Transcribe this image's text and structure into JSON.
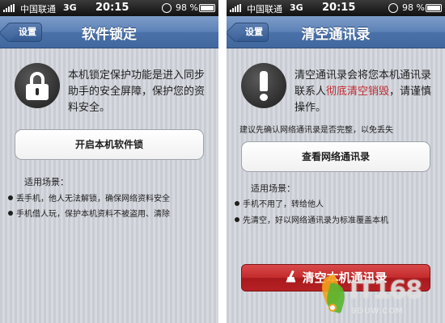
{
  "status_bar": {
    "carrier": "中国联通",
    "network": "3G",
    "time": "20:15",
    "battery_pct": "98 %",
    "battery_level": 0.98
  },
  "left_screen": {
    "back_label": "设置",
    "title": "软件锁定",
    "icon": "lock-icon",
    "description": "本机锁定保护功能是进入同步助手的安全屏障，保护您的资料安全。",
    "button_label": "开启本机软件锁",
    "scenarios_title": "适用场景：",
    "scenarios": [
      "丢手机，他人无法解锁，确保网络资料安全",
      "手机借人玩，保护本机资料不被盗用、清除"
    ]
  },
  "right_screen": {
    "back_label": "设置",
    "title": "清空通讯录",
    "icon": "exclamation-icon",
    "description_part1": "清空通讯录会将您本机通讯录联系人",
    "description_highlight": "彻底清空销毁",
    "description_part2": "，请谨慎操作。",
    "note": "建议先确认网络通讯录是否完整，以免丢失",
    "view_button_label": "查看网络通讯录",
    "scenarios_title": "适用场景：",
    "scenarios": [
      "手机不用了，转给他人",
      "先清空，好以网络通讯录为标准覆盖本机"
    ],
    "clear_button_label": "清空本机通讯录"
  },
  "watermark": {
    "text": "IT168",
    "sub": "9DUW.COM"
  },
  "colors": {
    "nav_blue": "#5c82b8",
    "danger_red": "#c42a2c",
    "highlight_red": "#c0282e"
  }
}
